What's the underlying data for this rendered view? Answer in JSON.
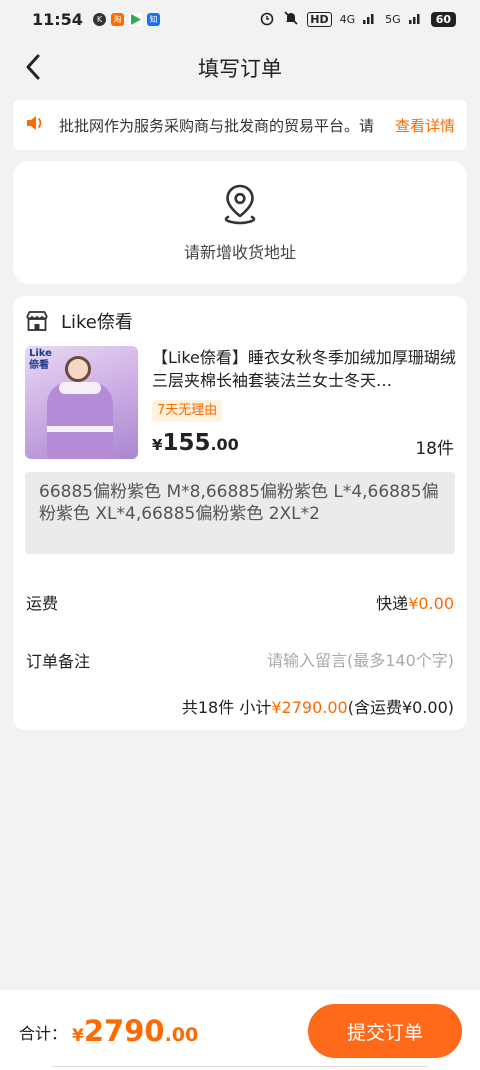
{
  "status_bar": {
    "time": "11:54",
    "network_4g": "4G",
    "network_5g": "5G",
    "hd": "HD",
    "battery": "60"
  },
  "nav": {
    "title": "填写订单"
  },
  "notice": {
    "text": "批批网作为服务采购商与批发商的贸易平台。请",
    "link": "查看详情"
  },
  "address": {
    "prompt": "请新增收货地址"
  },
  "order": {
    "shop_name": "Like倷看",
    "product": {
      "title": "【Like倷看】睡衣女秋冬季加绒加厚珊瑚绒三层夹棉长袖套装法兰女士冬天…",
      "image_badge_line1": "Like",
      "image_badge_line2": "倷看",
      "return_tag": "7天无理由",
      "price_symbol": "¥",
      "price_int": "155",
      "price_dec": ".00",
      "quantity": "18件"
    },
    "spec": "66885偏粉紫色 M*8,66885偏粉紫色 L*4,66885偏粉紫色 XL*4,66885偏粉紫色 2XL*2",
    "shipping": {
      "label": "运费",
      "method": "快递",
      "fee": "¥0.00"
    },
    "remark": {
      "label": "订单备注",
      "placeholder": "请输入留言(最多140个字)"
    },
    "summary": {
      "count": "共18件",
      "subtotal_label": "小计",
      "subtotal": "¥2790.00",
      "shipping_note": "(含运费¥0.00)"
    }
  },
  "bottom": {
    "total_label": "合计：",
    "total_symbol": "¥",
    "total_int": "2790",
    "total_dec": ".00",
    "submit_label": "提交订单"
  },
  "colors": {
    "accent": "#ff6a00",
    "background": "#f2f2f2"
  }
}
